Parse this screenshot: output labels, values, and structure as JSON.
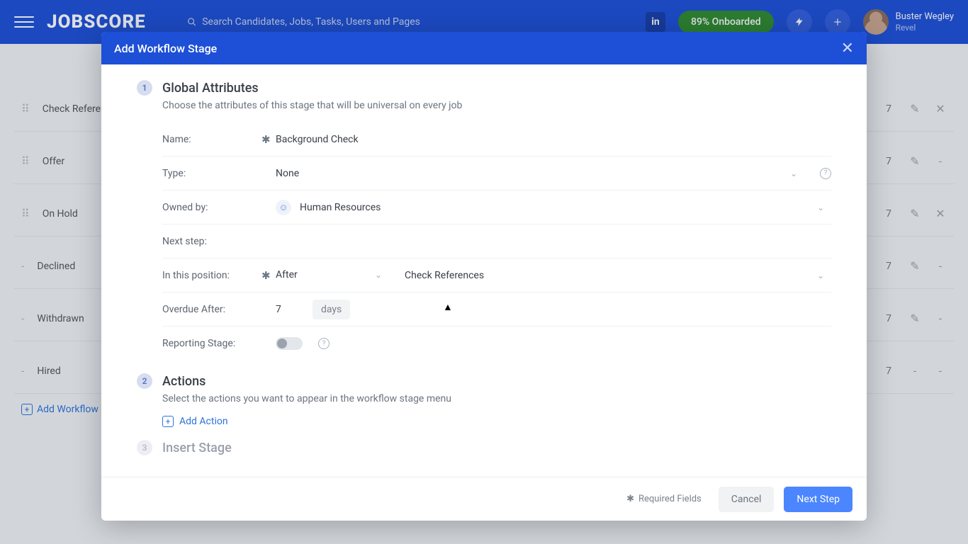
{
  "header": {
    "logo": "JOBSCORE",
    "search_placeholder": "Search Candidates, Jobs, Tasks, Users and Pages",
    "onboarded": "89% Onboarded",
    "user_name": "Buster Wegley",
    "user_org": "Revel"
  },
  "page": {
    "rows": [
      {
        "drag": "⠿",
        "name": "Check References",
        "n": "7",
        "edit": true,
        "del": true
      },
      {
        "drag": "⠿",
        "name": "Offer",
        "n": "7",
        "edit": true,
        "del": false
      },
      {
        "drag": "⠿",
        "name": "On Hold",
        "n": "7",
        "edit": true,
        "del": true
      },
      {
        "drag": "-",
        "name": "Declined",
        "n": "7",
        "edit": true,
        "del": false
      },
      {
        "drag": "-",
        "name": "Withdrawn",
        "n": "7",
        "edit": true,
        "del": false
      },
      {
        "drag": "-",
        "name": "Hired",
        "n": "7",
        "edit": false,
        "del": false
      }
    ],
    "add_workflow": "Add Workflow Stage"
  },
  "modal": {
    "title": "Add Workflow Stage",
    "section1": {
      "step": "1",
      "title": "Global Attributes",
      "desc": "Choose the attributes of this stage that will be universal on every job",
      "labels": {
        "name": "Name:",
        "type": "Type:",
        "owned_by": "Owned by:",
        "next_step": "Next step:",
        "position": "In this position:",
        "overdue": "Overdue After:",
        "reporting": "Reporting Stage:"
      },
      "values": {
        "name": "Background Check",
        "type": "None",
        "owned_by": "Human Resources",
        "position_rel": "After",
        "position_ref": "Check References",
        "overdue_num": "7",
        "overdue_unit": "days"
      }
    },
    "section2": {
      "step": "2",
      "title": "Actions",
      "desc": "Select the actions you want to appear in the workflow stage menu",
      "add": "Add Action"
    },
    "section3": {
      "step": "3",
      "title": "Insert Stage"
    },
    "footer": {
      "required": "Required Fields",
      "cancel": "Cancel",
      "next": "Next Step"
    }
  }
}
